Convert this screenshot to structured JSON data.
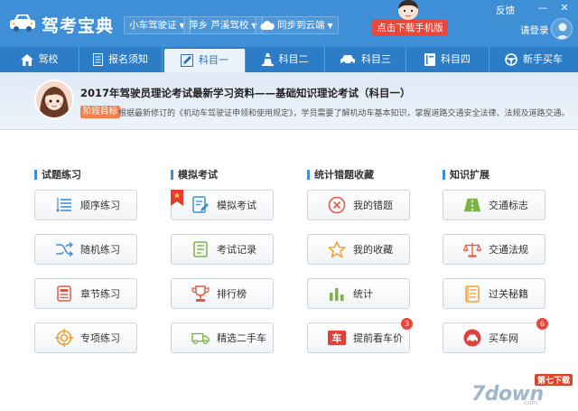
{
  "app": {
    "title": "驾考宝典"
  },
  "header": {
    "vehicle_select": "小车驾驶证",
    "school_select": "萍乡 芦溪驾校",
    "sync_label": "同步到云端",
    "download_label": "点击下载手机版",
    "feedback_label": "反馈",
    "login_label": "请登录",
    "min_glyph": "—",
    "close_glyph": "✕"
  },
  "nav": {
    "items": [
      {
        "label": "驾校",
        "icon": "house-icon",
        "active": false
      },
      {
        "label": "报名须知",
        "icon": "document-icon",
        "active": false
      },
      {
        "label": "科目一",
        "icon": "pencil-icon",
        "active": true
      },
      {
        "label": "科目二",
        "icon": "traffic-cone-icon",
        "active": false
      },
      {
        "label": "科目三",
        "icon": "car-icon",
        "active": false
      },
      {
        "label": "科目四",
        "icon": "book-icon",
        "active": false
      },
      {
        "label": "新手买车",
        "icon": "steering-wheel-icon",
        "active": false
      }
    ]
  },
  "banner": {
    "title": "2017年驾驶员理论考试最新学习资料——基础知识理论考试（科目一）",
    "stage_badge": "阶段目标",
    "description": "根据最新修订的《机动车驾驶证申领和使用规定》，学员需要了解机动车基本知识，掌握道路交通安全法律、法规及道路交通。"
  },
  "columns": [
    {
      "header": "试题练习",
      "items": [
        {
          "label": "顺序练习",
          "icon": "list-icon"
        },
        {
          "label": "随机练习",
          "icon": "shuffle-icon"
        },
        {
          "label": "章节练习",
          "icon": "chapter-icon"
        },
        {
          "label": "专项练习",
          "icon": "target-icon"
        }
      ]
    },
    {
      "header": "模拟考试",
      "items": [
        {
          "label": "模拟考试",
          "icon": "exam-icon"
        },
        {
          "label": "考试记录",
          "icon": "record-icon"
        },
        {
          "label": "排行榜",
          "icon": "trophy-icon"
        },
        {
          "label": "精选二手车",
          "icon": "truck-icon"
        }
      ]
    },
    {
      "header": "统计错题收藏",
      "items": [
        {
          "label": "我的错题",
          "icon": "wrong-icon"
        },
        {
          "label": "我的收藏",
          "icon": "star-icon"
        },
        {
          "label": "统计",
          "icon": "bar-chart-icon"
        },
        {
          "label": "提前看车价",
          "icon": "car-price-icon",
          "badge": "3"
        }
      ]
    },
    {
      "header": "知识扩展",
      "items": [
        {
          "label": "交通标志",
          "icon": "road-sign-icon"
        },
        {
          "label": "交通法规",
          "icon": "scales-icon"
        },
        {
          "label": "过关秘籍",
          "icon": "notebook-icon"
        },
        {
          "label": "买车网",
          "icon": "buy-car-icon",
          "badge": "6"
        }
      ]
    }
  ],
  "watermark": {
    "text": "7down",
    "top": "第七下载",
    "sub": ".com"
  },
  "colors": {
    "titlebar": "#3f8fd6",
    "nav": "#2d7cc6",
    "accent": "#3f8fd6",
    "badge": "#e9463c",
    "download": "#e9463c"
  }
}
